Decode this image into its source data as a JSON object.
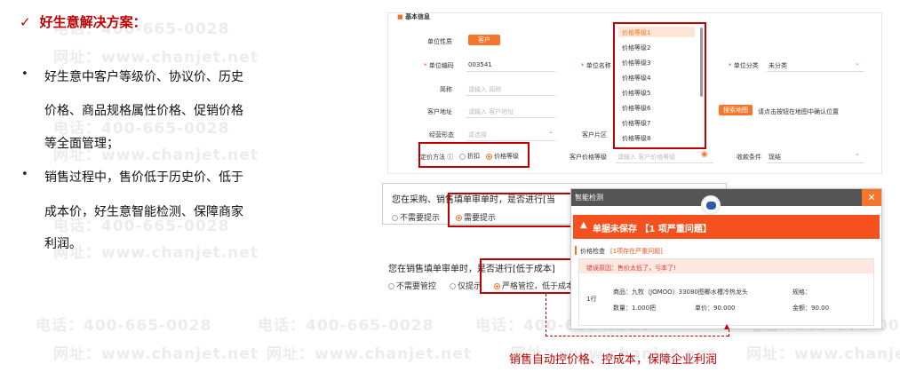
{
  "watermark": {
    "phone": "电话：400-665-0028",
    "site": "网址：www.chanjet.net"
  },
  "left": {
    "check": "✓",
    "title": "好生意解决方案：",
    "bullet": "•",
    "lines": [
      "好生意中客户等级价、协议价、历史",
      "价格、商品规格属性价格、促销价格",
      "等全面管理；",
      "销售过程中，售价低于历史价、低于",
      "成本价，好生意智能检测、保障商家",
      "利润。"
    ]
  },
  "form": {
    "section": "基本信息",
    "unit_type_label": "单位性质",
    "unit_type_value": "客户",
    "code_label": "单位编码",
    "code_value": "003541",
    "name_label": "单位名称",
    "category_label": "单位分类",
    "category_value": "未分类",
    "short_label": "简称",
    "short_ph": "请输入 简称",
    "address_label": "客户地址",
    "address_ph": "请输入 客户地址",
    "map_btn": "搜索地图",
    "map_hint": "请点击按钮在地图中确认位置",
    "biz_label": "经营形态",
    "biz_ph": "请选择",
    "area_label": "客户片区",
    "price_method_label": "定价方法 ⓘ",
    "opt_discount": "折扣",
    "opt_level": "价格等级",
    "cust_level_label": "客户价格等级",
    "cust_level_ph": "请输入 客户价格等级",
    "collect_label": "收款条件",
    "collect_value": "现结"
  },
  "dropdown": [
    "价格等级1",
    "价格等级2",
    "价格等级3",
    "价格等级4",
    "价格等级5",
    "价格等级6",
    "价格等级7",
    "价格等级8"
  ],
  "purchase": {
    "q": "您在采购、销售填单审单时，是否进行[当",
    "opt_no": "不需要提示",
    "opt_yes": "需要提示"
  },
  "cost": {
    "q": "您在销售填单审单时，是否进行[低于成本]",
    "opt1": "不需要管控",
    "opt2": "仅提示",
    "opt3": "严格管控，低于成本"
  },
  "dialog": {
    "title": "智能检测",
    "close": "✕",
    "alert": "单据未保存 【1 项严重问题】",
    "section": "价格检查",
    "section_note": "[1项存在严重问题]",
    "error": "错误原因：售价太低了，亏本了!",
    "row_no": "1行",
    "product": "商品：九牧（JOMOO）33080图椰水槽冷热龙头",
    "spec": "规格：",
    "qty": "数量：1.000把",
    "price": "单价：90.000",
    "amount": "金额：90.00"
  },
  "caption": "销售自动控价格、控成本，保障企业利润",
  "colors": {
    "accent": "#f5762a",
    "red": "#c00000",
    "alert": "#f4511e"
  }
}
